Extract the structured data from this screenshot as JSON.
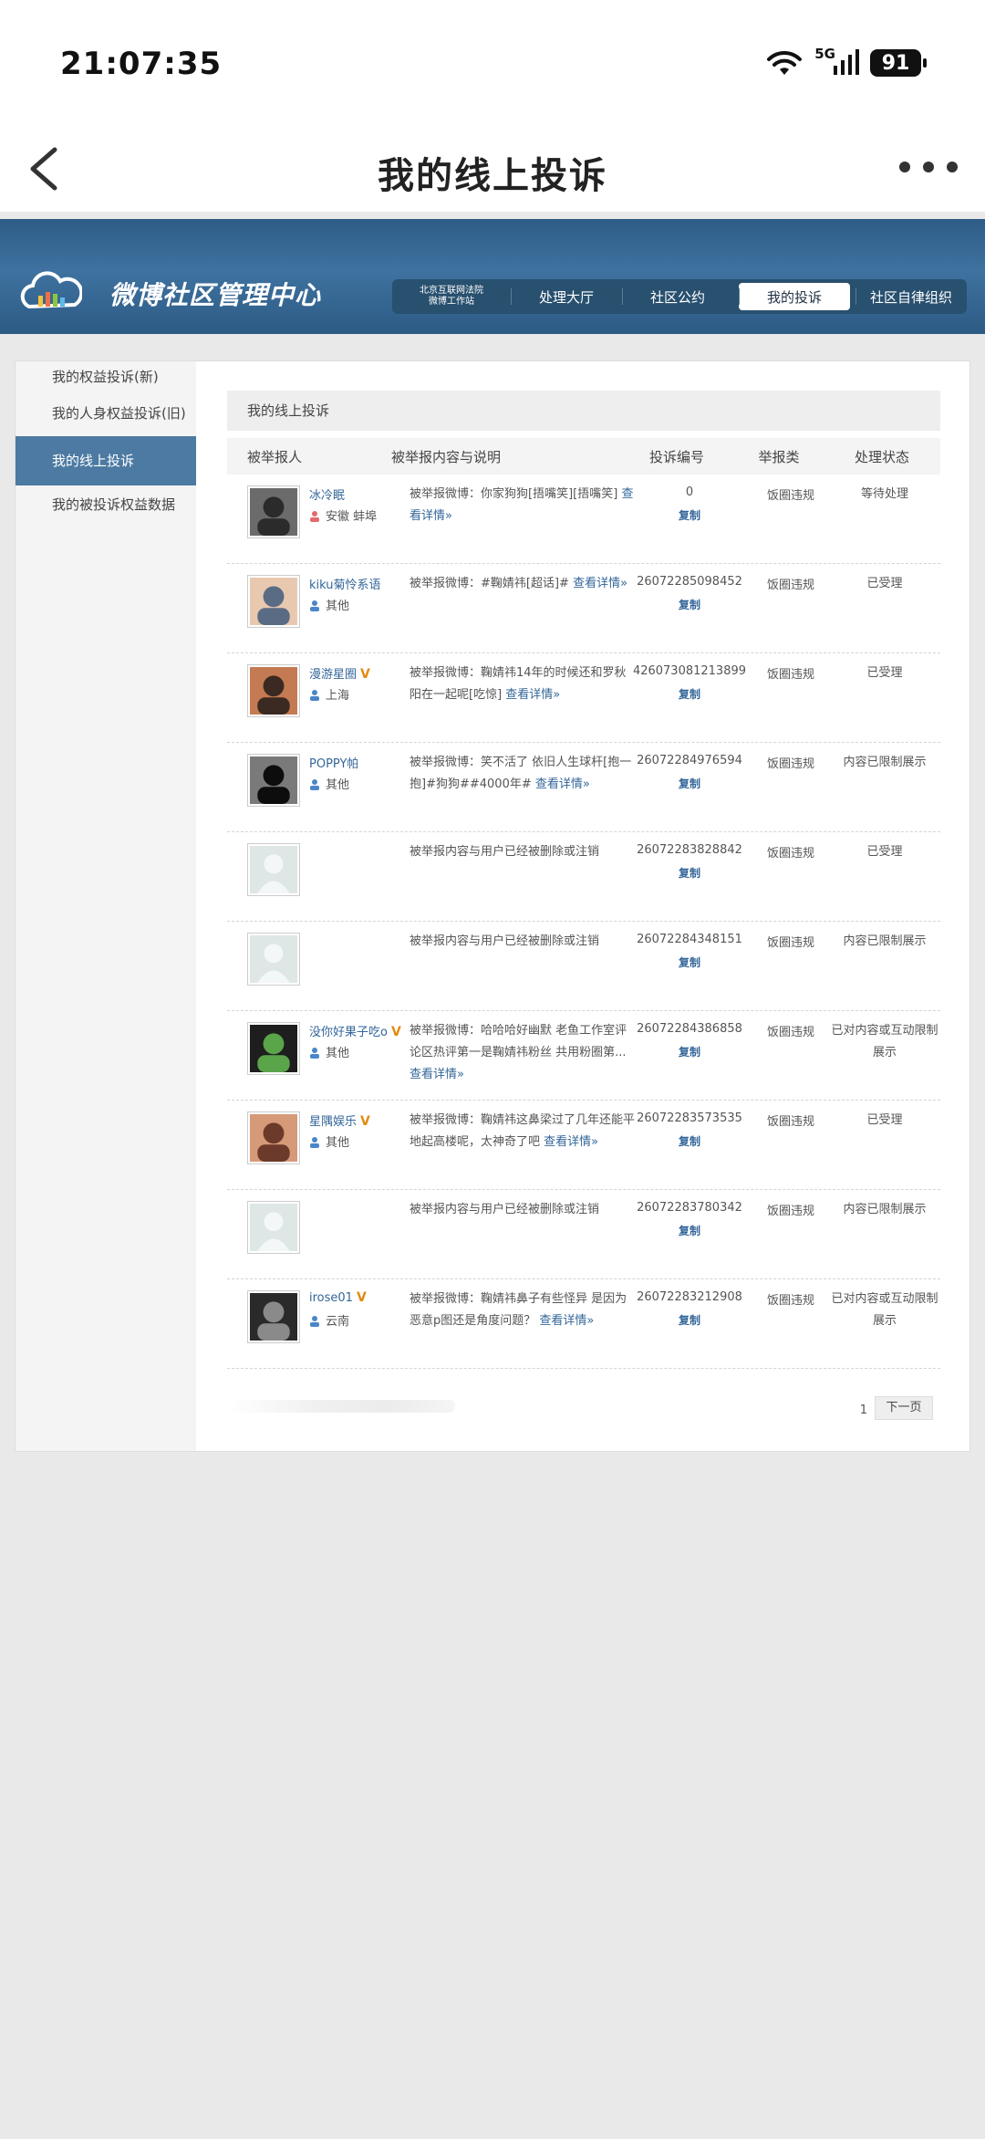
{
  "status_bar": {
    "time": "21:07:35",
    "network": "5G",
    "battery": "91"
  },
  "nav": {
    "title": "我的线上投诉"
  },
  "site": {
    "name": "微博社区管理中心",
    "nav": {
      "beijing_line1": "北京互联网法院",
      "beijing_line2": "微博工作站",
      "items": [
        "处理大厅",
        "社区公约",
        "我的投诉",
        "社区自律组织"
      ],
      "active": "我的投诉"
    }
  },
  "sidebar": {
    "items": [
      "我的权益投诉(新)",
      "我的人身权益投诉(旧)",
      "我的线上投诉",
      "我的被投诉权益数据"
    ],
    "active": "我的线上投诉"
  },
  "main": {
    "box_title": "我的线上投诉",
    "columns": [
      "被举报人",
      "被举报内容与说明",
      "投诉编号",
      "举报类",
      "处理状态"
    ],
    "rows": [
      {
        "name": "冰冷眠",
        "verified": false,
        "location": "安徽 蚌埠",
        "gender": "female",
        "desc": "被举报微博：你家狗狗[捂嘴笑][捂嘴笑]",
        "more": "查看详情»",
        "id": "0",
        "copy": "复制",
        "category": "饭圈违规",
        "status": "等待处理"
      },
      {
        "name": "kiku菊怜系语",
        "verified": false,
        "location": "其他",
        "gender": "male",
        "desc": "被举报微博：#鞠婧祎[超话]#",
        "more": "查看详情»",
        "id": "26072285098452",
        "copy": "复制",
        "category": "饭圈违规",
        "status": "已受理"
      },
      {
        "name": "漫游星圈",
        "verified": true,
        "location": "上海",
        "gender": "male",
        "desc": "被举报微博：鞠婧祎14年的时候还和罗秋阳在一起呢[吃惊]",
        "more": "查看详情»",
        "id": "426073081213899",
        "copy": "复制",
        "category": "饭圈违规",
        "status": "已受理"
      },
      {
        "name": "POPPY帕",
        "verified": false,
        "location": "其他",
        "gender": "male",
        "desc": "被举报微博：笑不活了 依旧人生球杆[抱一抱]#狗狗##4000年#",
        "more": "查看详情»",
        "id": "26072284976594",
        "copy": "复制",
        "category": "饭圈违规",
        "status": "内容已限制展示"
      },
      {
        "name": "",
        "verified": false,
        "location": "",
        "gender": "",
        "desc": "被举报内容与用户已经被删除或注销",
        "more": "",
        "id": "26072283828842",
        "copy": "复制",
        "category": "饭圈违规",
        "status": "已受理"
      },
      {
        "name": "",
        "verified": false,
        "location": "",
        "gender": "",
        "desc": "被举报内容与用户已经被删除或注销",
        "more": "",
        "id": "26072284348151",
        "copy": "复制",
        "category": "饭圈违规",
        "status": "内容已限制展示"
      },
      {
        "name": "没你好果子吃o",
        "verified": true,
        "location": "其他",
        "gender": "male",
        "desc": "被举报微博：哈哈哈好幽默 老鱼工作室评论区热评第一是鞠婧祎粉丝 共用粉圈第...",
        "more": "查看详情»",
        "id": "26072284386858",
        "copy": "复制",
        "category": "饭圈违规",
        "status": "已对内容或互动限制展示"
      },
      {
        "name": "星隅娱乐",
        "verified": true,
        "location": "其他",
        "gender": "male",
        "desc": "被举报微博：鞠婧祎这鼻梁过了几年还能平地起高楼呢，太神奇了吧",
        "more": "查看详情»",
        "id": "26072283573535",
        "copy": "复制",
        "category": "饭圈违规",
        "status": "已受理"
      },
      {
        "name": "",
        "verified": false,
        "location": "",
        "gender": "",
        "desc": "被举报内容与用户已经被删除或注销",
        "more": "",
        "id": "26072283780342",
        "copy": "复制",
        "category": "饭圈违规",
        "status": "内容已限制展示"
      },
      {
        "name": "irose01",
        "verified": true,
        "location": "云南",
        "gender": "male",
        "desc": "被举报微博：鞠婧祎鼻子有些怪异 是因为恶意p图还是角度问题？",
        "more": "查看详情»",
        "id": "26072283212908",
        "copy": "复制",
        "category": "饭圈违规",
        "status": "已对内容或互动限制展示"
      }
    ],
    "pager": {
      "page": "1",
      "next": "下一页"
    }
  },
  "colors": {
    "header_blue": "#3f72a0",
    "active_side": "#4c7aa2",
    "link": "#336699",
    "badge": "#e28a13"
  }
}
